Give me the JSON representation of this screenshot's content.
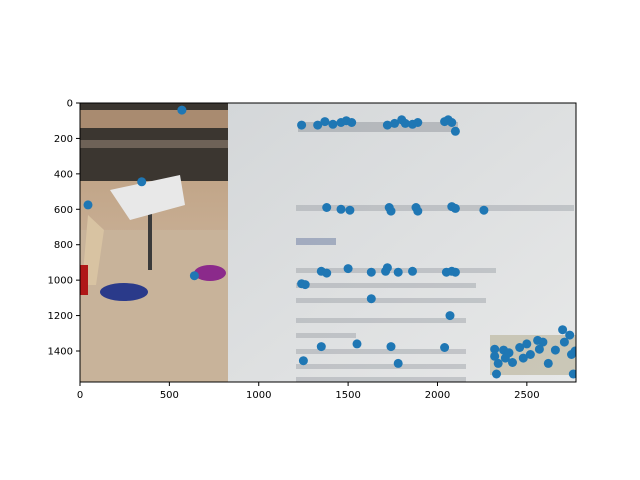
{
  "chart_data": {
    "type": "scatter",
    "title": "",
    "xlabel": "",
    "ylabel": "",
    "xlim": [
      0,
      2775
    ],
    "ylim": [
      1575,
      0
    ],
    "y_inverted": true,
    "grid": false,
    "legend": "none",
    "background": "photo of a desk with Lego toys and a textbook page (Chinese text)",
    "xticks": [
      0,
      500,
      1000,
      1500,
      2000,
      2500
    ],
    "yticks": [
      0,
      200,
      400,
      600,
      800,
      1000,
      1200,
      1400
    ],
    "marker_color": "#1f77b4",
    "points": [
      [
        570,
        40
      ],
      [
        345,
        445
      ],
      [
        45,
        575
      ],
      [
        640,
        975
      ],
      [
        1240,
        125
      ],
      [
        1330,
        125
      ],
      [
        1370,
        105
      ],
      [
        1415,
        120
      ],
      [
        1460,
        110
      ],
      [
        1490,
        100
      ],
      [
        1520,
        110
      ],
      [
        1720,
        125
      ],
      [
        1760,
        115
      ],
      [
        1800,
        95
      ],
      [
        1820,
        115
      ],
      [
        1860,
        120
      ],
      [
        1890,
        110
      ],
      [
        2040,
        105
      ],
      [
        2060,
        95
      ],
      [
        2080,
        110
      ],
      [
        2100,
        160
      ],
      [
        1380,
        590
      ],
      [
        1460,
        600
      ],
      [
        1510,
        605
      ],
      [
        1730,
        590
      ],
      [
        1740,
        610
      ],
      [
        1880,
        590
      ],
      [
        1890,
        610
      ],
      [
        2080,
        585
      ],
      [
        2100,
        595
      ],
      [
        2260,
        605
      ],
      [
        1240,
        1020
      ],
      [
        1260,
        1025
      ],
      [
        1350,
        950
      ],
      [
        1380,
        960
      ],
      [
        1500,
        935
      ],
      [
        1630,
        955
      ],
      [
        1710,
        950
      ],
      [
        1720,
        930
      ],
      [
        1780,
        955
      ],
      [
        1860,
        950
      ],
      [
        2050,
        955
      ],
      [
        2080,
        950
      ],
      [
        2100,
        955
      ],
      [
        1630,
        1105
      ],
      [
        2070,
        1200
      ],
      [
        1350,
        1375
      ],
      [
        1550,
        1360
      ],
      [
        1740,
        1375
      ],
      [
        2040,
        1380
      ],
      [
        1250,
        1455
      ],
      [
        1780,
        1470
      ],
      [
        2320,
        1390
      ],
      [
        2320,
        1430
      ],
      [
        2340,
        1470
      ],
      [
        2330,
        1530
      ],
      [
        2370,
        1395
      ],
      [
        2380,
        1440
      ],
      [
        2400,
        1410
      ],
      [
        2420,
        1465
      ],
      [
        2460,
        1380
      ],
      [
        2480,
        1440
      ],
      [
        2500,
        1360
      ],
      [
        2520,
        1420
      ],
      [
        2560,
        1340
      ],
      [
        2570,
        1390
      ],
      [
        2590,
        1350
      ],
      [
        2620,
        1470
      ],
      [
        2660,
        1395
      ],
      [
        2700,
        1280
      ],
      [
        2710,
        1350
      ],
      [
        2740,
        1310
      ],
      [
        2750,
        1420
      ],
      [
        2760,
        1530
      ],
      [
        2770,
        1400
      ]
    ]
  }
}
